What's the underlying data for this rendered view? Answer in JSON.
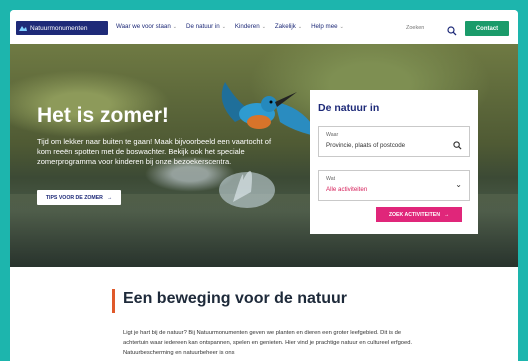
{
  "header": {
    "logo_text": "Natuurmonumenten",
    "nav": [
      {
        "label": "Waar we voor staan",
        "has_dropdown": true
      },
      {
        "label": "De natuur in",
        "has_dropdown": true
      },
      {
        "label": "Kinderen",
        "has_dropdown": true
      },
      {
        "label": "Zakelijk",
        "has_dropdown": true
      },
      {
        "label": "Help mee",
        "has_dropdown": true
      }
    ],
    "search_placeholder": "Zoeken",
    "contact_label": "Contact"
  },
  "hero": {
    "title": "Het is zomer!",
    "text": "Tijd om lekker naar buiten te gaan! Maak bijvoorbeeld een vaartocht of kom reeën spotten met de boswachter. Bekijk ook het speciale zomerprogramma voor kinderen bij onze bezoekerscentra.",
    "button_label": "TIPS VOOR DE ZOMER"
  },
  "search_card": {
    "title": "De natuur in",
    "where_label": "Waar",
    "where_placeholder": "Provincie, plaats of postcode",
    "what_label": "Wat",
    "what_value": "Alle activiteiten",
    "submit_label": "ZOEK ACTIVITEITEN"
  },
  "intro": {
    "title": "Een beweging voor de natuur",
    "text": "Ligt je hart bij de natuur? Bij Natuurmonumenten geven we planten en dieren een groter leefgebied. Dit is de achtertuin waar iedereen kan ontspannen, spelen en genieten. Hier vind je prachtige natuur en cultureel erfgoed. Natuurbescherming en natuurbeheer is ons"
  },
  "colors": {
    "brand_navy": "#1e2a78",
    "contact_green": "#1a9b6a",
    "accent_pink": "#e0267a",
    "accent_orange": "#e0592a",
    "background_teal": "#1db5ad"
  }
}
